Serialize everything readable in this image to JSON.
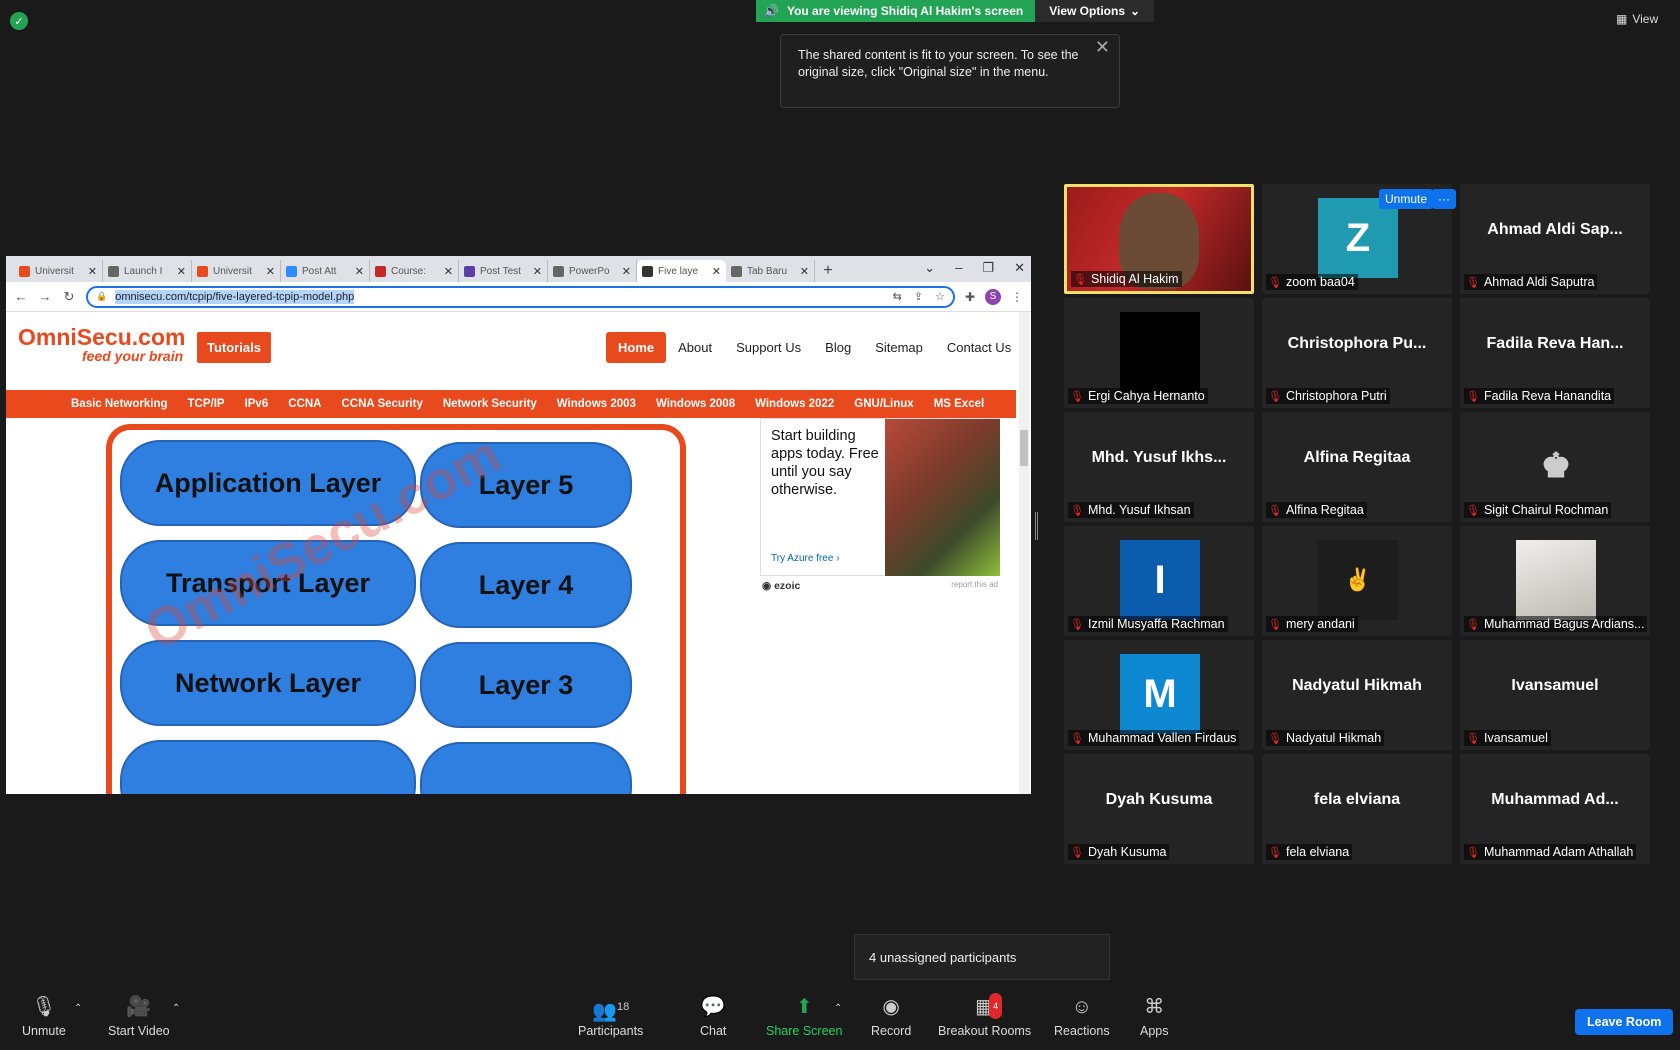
{
  "zoom_bar": {
    "viewing_text": "You are viewing Shidiq Al Hakim's screen",
    "view_options": "View Options",
    "tooltip": "The shared content is fit to your screen. To see the original size, click \"Original size\" in the menu.",
    "view_label": "View"
  },
  "browser": {
    "tabs": [
      {
        "label": "Universit",
        "icon_color": "#e8491d",
        "icon": "html5-icon"
      },
      {
        "label": "Launch I",
        "icon_color": "#666666",
        "icon": "globe-icon"
      },
      {
        "label": "Universit",
        "icon_color": "#e8491d",
        "icon": "html5-icon"
      },
      {
        "label": "Post Att",
        "icon_color": "#2d8cff",
        "icon": "zoom-icon"
      },
      {
        "label": "Course:",
        "icon_color": "#c62828",
        "icon": "shield-icon"
      },
      {
        "label": "Post Test",
        "icon_color": "#5b3fa8",
        "icon": "form-icon"
      },
      {
        "label": "PowerPo",
        "icon_color": "#666666",
        "icon": "globe-icon"
      },
      {
        "label": "Five laye",
        "icon_color": "#333333",
        "icon": "link-icon"
      },
      {
        "label": "Tab Baru",
        "icon_color": "#666666",
        "icon": "globe-icon"
      }
    ],
    "url": "omnisecu.com/tcpip/five-layered-tcpip-model.php",
    "profile_initial": "S"
  },
  "site": {
    "logo_main": "OmniSecu",
    "logo_domain": ".com",
    "tagline": "feed your brain",
    "tutorials_btn": "Tutorials",
    "main_nav": [
      "Home",
      "About",
      "Support Us",
      "Blog",
      "Sitemap",
      "Contact Us"
    ],
    "cat_nav": [
      "Basic Networking",
      "TCP/IP",
      "IPv6",
      "CCNA",
      "CCNA Security",
      "Network Security",
      "Windows 2003",
      "Windows 2008",
      "Windows 2022",
      "GNU/Linux",
      "MS Excel"
    ],
    "layers": [
      {
        "name": "Application Layer",
        "num": "Layer 5"
      },
      {
        "name": "Transport Layer",
        "num": "Layer 4"
      },
      {
        "name": "Network Layer",
        "num": "Layer 3"
      }
    ],
    "watermark": "OmniSecu.com",
    "ad": {
      "text": "Start building apps today. Free until you say otherwise.",
      "cta": "Try Azure free",
      "brand": "ezoic",
      "report": "report this ad"
    }
  },
  "gallery": {
    "unmute_label": "Unmute",
    "more_label": "···",
    "tiles": [
      {
        "display": "",
        "label": "Shidiq Al Hakim",
        "type": "video"
      },
      {
        "display": "Z",
        "label": "zoom baa04",
        "type": "letter",
        "color": "#1f9ab0"
      },
      {
        "display": "Ahmad Aldi Sap...",
        "label": "Ahmad Aldi Saputra",
        "type": "name"
      },
      {
        "display": "",
        "label": "Ergi Cahya Hernanto",
        "type": "black"
      },
      {
        "display": "Christophora Pu...",
        "label": "Christophora Putri",
        "type": "name"
      },
      {
        "display": "Fadila Reva Han...",
        "label": "Fadila Reva Hanandita",
        "type": "name"
      },
      {
        "display": "Mhd. Yusuf Ikhs...",
        "label": "Mhd. Yusuf Ikhsan",
        "type": "name"
      },
      {
        "display": "Alfina Regitaa",
        "label": "Alfina Regitaa",
        "type": "name"
      },
      {
        "display": "",
        "label": "Sigit Chairul Rochman",
        "type": "emblem"
      },
      {
        "display": "I",
        "label": "Izmil Musyaffa Rachman",
        "type": "letter",
        "color": "#0b5cad"
      },
      {
        "display": "",
        "label": "mery andani",
        "type": "photo-dark"
      },
      {
        "display": "",
        "label": "Muhammad Bagus Ardians...",
        "type": "photo-light"
      },
      {
        "display": "M",
        "label": "Muhammad Vallen Firdaus",
        "type": "letter",
        "color": "#0e88d0"
      },
      {
        "display": "Nadyatul Hikmah",
        "label": "Nadyatul Hikmah",
        "type": "name"
      },
      {
        "display": "Ivansamuel",
        "label": "Ivansamuel",
        "type": "name"
      },
      {
        "display": "Dyah Kusuma",
        "label": "Dyah Kusuma",
        "type": "name"
      },
      {
        "display": "fela elviana",
        "label": "fela elviana",
        "type": "name"
      },
      {
        "display": "Muhammad Ad...",
        "label": "Muhammad Adam Athallah",
        "type": "name"
      }
    ]
  },
  "unassigned": "4 unassigned participants",
  "toolbar": {
    "unmute": "Unmute",
    "start_video": "Start Video",
    "participants": "Participants",
    "participants_count": "18",
    "chat": "Chat",
    "share_screen": "Share Screen",
    "record": "Record",
    "breakout_rooms": "Breakout Rooms",
    "breakout_badge": "4",
    "reactions": "Reactions",
    "apps": "Apps",
    "leave_room": "Leave Room"
  }
}
